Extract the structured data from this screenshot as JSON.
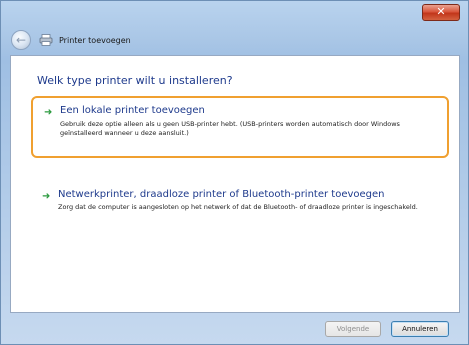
{
  "window": {
    "title": "Printer toevoegen",
    "close_label": "✕"
  },
  "icons": {
    "back": "back-arrow-icon",
    "printer": "printer-icon",
    "option_arrow": "green-arrow-icon"
  },
  "colors": {
    "heading": "#1e3a8c",
    "selection_border": "#f0a030",
    "arrow": "#2c9a3f",
    "close_button": "#d9573d"
  },
  "main": {
    "heading": "Welk type printer wilt u installeren?",
    "options": [
      {
        "title": "Een lokale printer toevoegen",
        "description": "Gebruik deze optie alleen als u geen USB-printer hebt. (USB-printers worden automatisch door Windows geïnstalleerd wanneer u deze aansluit.)",
        "selected": true
      },
      {
        "title": "Netwerkprinter, draadloze printer of Bluetooth-printer toevoegen",
        "description": "Zorg dat de computer is aangesloten op het netwerk of dat de Bluetooth- of draadloze printer is ingeschakeld.",
        "selected": false
      }
    ]
  },
  "footer": {
    "next_label": "Volgende",
    "cancel_label": "Annuleren"
  }
}
